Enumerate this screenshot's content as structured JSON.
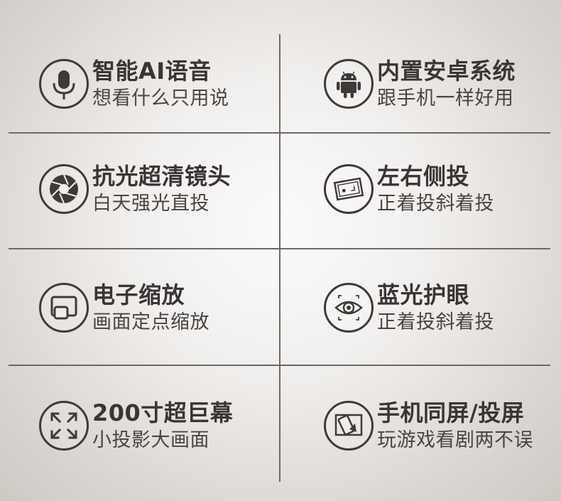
{
  "features": [
    {
      "title": "智能AI语音",
      "subtitle": "想看什么只用说"
    },
    {
      "title": "内置安卓系统",
      "subtitle": "跟手机一样好用"
    },
    {
      "title": "抗光超清镜头",
      "subtitle": "白天强光直投"
    },
    {
      "title": "左右侧投",
      "subtitle": "正着投斜着投"
    },
    {
      "title": "电子缩放",
      "subtitle": "画面定点缩放"
    },
    {
      "title": "蓝光护眼",
      "subtitle": "正着投斜着投"
    },
    {
      "title": "200寸超巨幕",
      "subtitle": "小投影大画面"
    },
    {
      "title": "手机同屏/投屏",
      "subtitle": "玩游戏看剧两不误"
    }
  ],
  "icons": [
    "microphone-icon",
    "android-icon",
    "lens-aperture-icon",
    "side-projection-icon",
    "zoom-screen-icon",
    "eye-care-icon",
    "expand-arrows-icon",
    "phone-mirror-icon"
  ],
  "colors": {
    "text": "#3a3534",
    "divider": "#6e6866",
    "icon": "#3f3a38"
  }
}
